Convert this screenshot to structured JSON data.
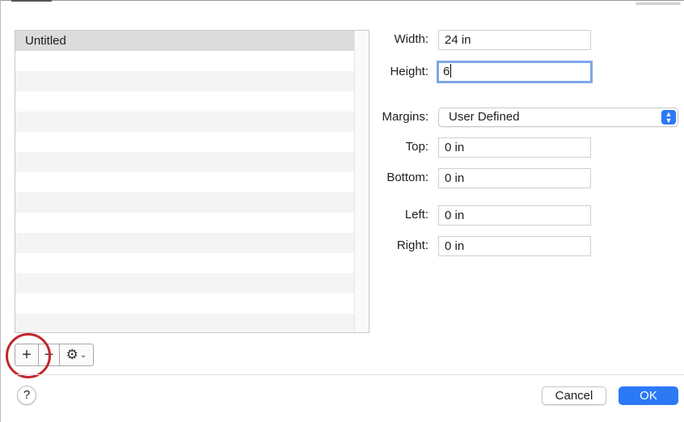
{
  "paper_sizes": {
    "items": [
      {
        "label": "Untitled",
        "selected": true
      }
    ]
  },
  "buttons": {
    "add_icon": "plus-icon",
    "add_label": "+",
    "remove_icon": "minus-icon",
    "remove_label": "−",
    "action_icon": "gear-icon",
    "action_gear": "⚙",
    "action_chevron": "⌄"
  },
  "size": {
    "width_label": "Width:",
    "width_value": "24 in",
    "height_label": "Height:",
    "height_value": "6"
  },
  "margins": {
    "label": "Margins:",
    "selected": "User Defined",
    "top_label": "Top:",
    "top_value": "0 in",
    "bottom_label": "Bottom:",
    "bottom_value": "0 in",
    "left_label": "Left:",
    "left_value": "0 in",
    "right_label": "Right:",
    "right_value": "0 in"
  },
  "footer": {
    "help_label": "?",
    "cancel_label": "Cancel",
    "ok_label": "OK"
  },
  "colors": {
    "accent": "#2c79f6",
    "focus_ring": "#7ea6e8",
    "highlight_circle": "#c0262d",
    "selected_row": "#dcdcdc"
  }
}
